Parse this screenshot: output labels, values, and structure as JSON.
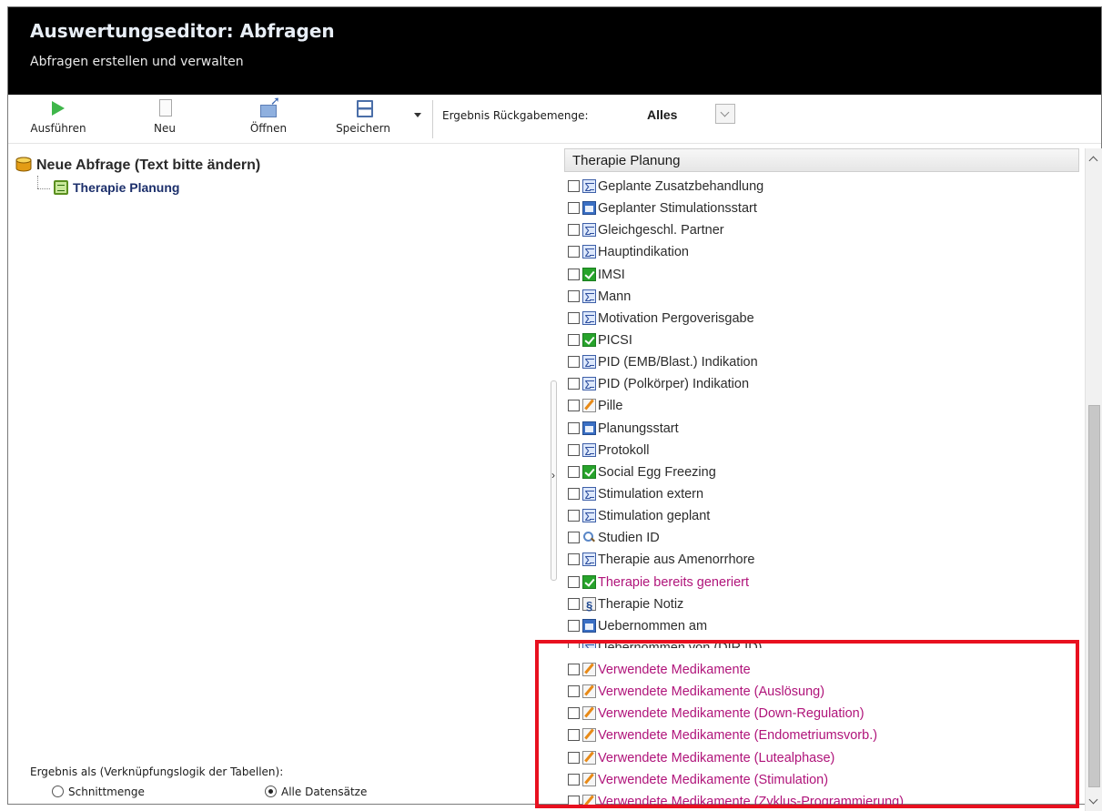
{
  "header": {
    "title": "Auswertungseditor: Abfragen",
    "subtitle": "Abfragen erstellen und verwalten"
  },
  "toolbar": {
    "buttons": [
      {
        "label": "Ausführen",
        "icon": "play-icon"
      },
      {
        "label": "Neu",
        "icon": "new-document-icon"
      },
      {
        "label": "Öffnen",
        "icon": "open-folder-icon"
      },
      {
        "label": "Speichern",
        "icon": "save-icon"
      }
    ],
    "result_label": "Ergebnis Rückgabemenge:",
    "result_value": "Alles"
  },
  "tree": {
    "root_label": "Neue Abfrage (Text bitte ändern)",
    "child_label": "Therapie Planung"
  },
  "result_as": {
    "label": "Ergebnis als (Verknüpfungslogik der Tabellen):",
    "options": [
      {
        "label": "Schnittmenge",
        "selected": false
      },
      {
        "label": "Alle Datensätze",
        "selected": true
      }
    ]
  },
  "field_panel": {
    "header": "Therapie Planung",
    "fields": [
      {
        "label": "Geplante Zusatzbehandlung",
        "icon": "sum-icon",
        "pink": false
      },
      {
        "label": "Geplanter Stimulationsstart",
        "icon": "date-icon",
        "pink": false
      },
      {
        "label": "Gleichgeschl. Partner",
        "icon": "sum-icon",
        "pink": false
      },
      {
        "label": "Hauptindikation",
        "icon": "sum-icon",
        "pink": false
      },
      {
        "label": "IMSI",
        "icon": "check-icon",
        "pink": false
      },
      {
        "label": "Mann",
        "icon": "sum-icon",
        "pink": false
      },
      {
        "label": "Motivation Pergoverisgabe",
        "icon": "sum-icon",
        "pink": false
      },
      {
        "label": "PICSI",
        "icon": "check-icon",
        "pink": false
      },
      {
        "label": "PID (EMB/Blast.) Indikation",
        "icon": "sum-icon",
        "pink": false
      },
      {
        "label": "PID (Polkörper) Indikation",
        "icon": "sum-icon",
        "pink": false
      },
      {
        "label": "Pille",
        "icon": "edit-icon",
        "pink": false
      },
      {
        "label": "Planungsstart",
        "icon": "date-icon",
        "pink": false
      },
      {
        "label": "Protokoll",
        "icon": "sum-icon",
        "pink": false
      },
      {
        "label": "Social Egg Freezing",
        "icon": "check-icon",
        "pink": false
      },
      {
        "label": "Stimulation extern",
        "icon": "sum-icon",
        "pink": false
      },
      {
        "label": "Stimulation geplant",
        "icon": "sum-icon",
        "pink": false
      },
      {
        "label": "Studien ID",
        "icon": "search-icon",
        "pink": false
      },
      {
        "label": "Therapie aus Amenorrhore",
        "icon": "sum-icon",
        "pink": false
      },
      {
        "label": "Therapie bereits generiert",
        "icon": "check-icon",
        "pink": true
      },
      {
        "label": "Therapie Notiz",
        "icon": "note-icon",
        "pink": false
      },
      {
        "label": "Uebernommen am",
        "icon": "date-icon",
        "pink": false
      },
      {
        "label": "Uebernommen von (DIR ID)",
        "icon": "sum-icon",
        "pink": false
      },
      {
        "label": "Verwendete Medikamente",
        "icon": "edit-icon",
        "pink": true
      },
      {
        "label": "Verwendete Medikamente (Auslösung)",
        "icon": "edit-icon",
        "pink": true
      },
      {
        "label": "Verwendete Medikamente (Down-Regulation)",
        "icon": "edit-icon",
        "pink": true
      },
      {
        "label": "Verwendete Medikamente (Endometriumsvorb.)",
        "icon": "edit-icon",
        "pink": true
      },
      {
        "label": "Verwendete Medikamente (Lutealphase)",
        "icon": "edit-icon",
        "pink": true
      },
      {
        "label": "Verwendete Medikamente (Stimulation)",
        "icon": "edit-icon",
        "pink": true
      },
      {
        "label": "Verwendete Medikamente (Zyklus-Programmierung)",
        "icon": "edit-icon",
        "pink": true
      }
    ]
  },
  "colors": {
    "header_bg": "#000000",
    "highlight_border": "#e8101f",
    "pink_text": "#b0147a",
    "tree_child_text": "#1c2f6b"
  }
}
